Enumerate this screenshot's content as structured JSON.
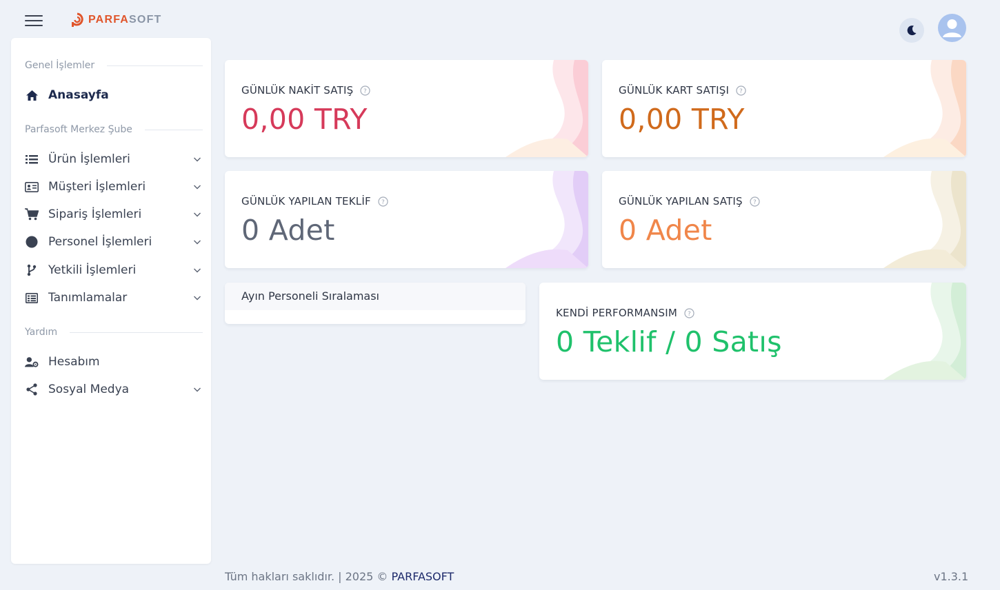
{
  "brand": {
    "part1": "PARFA",
    "part2": "SOFT",
    "accent": "#e0552b"
  },
  "sidebar": {
    "sections": [
      {
        "label": "Genel İşlemler"
      },
      {
        "label": "Parfasoft Merkez Şube"
      },
      {
        "label": "Yardım"
      }
    ],
    "items": [
      {
        "label": "Anasayfa",
        "icon": "home-icon"
      },
      {
        "label": "Ürün İşlemleri",
        "icon": "list-icon"
      },
      {
        "label": "Müşteri İşlemleri",
        "icon": "id-card-icon"
      },
      {
        "label": "Sipariş İşlemleri",
        "icon": "cart-icon"
      },
      {
        "label": "Personel İşlemleri",
        "icon": "circle-icon"
      },
      {
        "label": "Yetkili İşlemleri",
        "icon": "branch-icon"
      },
      {
        "label": "Tanımlamalar",
        "icon": "table-icon"
      },
      {
        "label": "Hesabım",
        "icon": "user-gear-icon"
      },
      {
        "label": "Sosyal Medya",
        "icon": "share-icon"
      }
    ]
  },
  "cards": {
    "cash": {
      "title": "GÜNLÜK NAKİT SATIŞ",
      "value": "0,00 TRY",
      "color": "#d63a5a"
    },
    "card": {
      "title": "GÜNLÜK KART SATIŞI",
      "value": "0,00 TRY",
      "color": "#d06a1c"
    },
    "offers": {
      "title": "GÜNLÜK YAPILAN TEKLİF",
      "value": "0 Adet",
      "color": "#5f6777"
    },
    "sales": {
      "title": "GÜNLÜK YAPILAN SATIŞ",
      "value": "0 Adet",
      "color": "#f0864a"
    },
    "performance": {
      "title": "KENDİ PERFORMANSIM",
      "value": "0 Teklif / 0 Satış",
      "color": "#1fc16b"
    }
  },
  "ranking": {
    "title": "Ayın Personeli Sıralaması"
  },
  "footer": {
    "copyright": "Tüm hakları saklıdır. | 2025 ©",
    "brand": "PARFASOFT",
    "version": "v1.3.1"
  }
}
